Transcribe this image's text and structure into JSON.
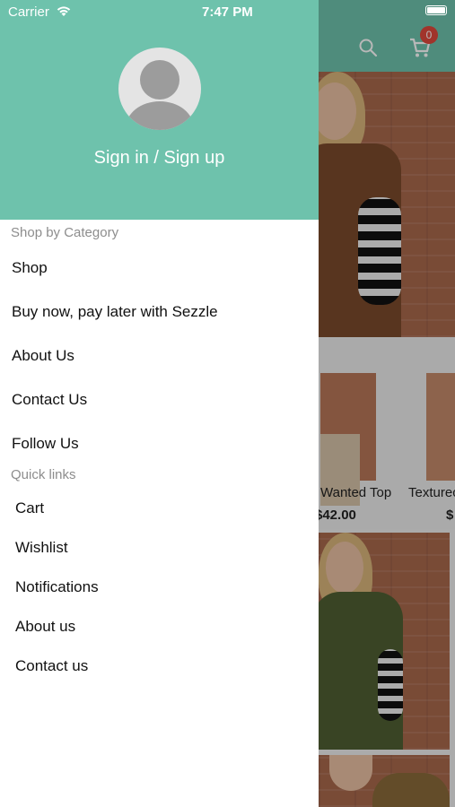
{
  "status_bar": {
    "carrier": "Carrier",
    "time": "7:47 PM"
  },
  "background": {
    "cart_badge": "0",
    "products": [
      {
        "name": "Wanted Top",
        "price": "$42.00"
      },
      {
        "name": "Texturec",
        "price": "$"
      }
    ],
    "icons": [
      "search-icon",
      "cart-icon"
    ]
  },
  "drawer": {
    "signin_label": "Sign in / Sign up",
    "shop_by_category": {
      "title": "Shop by Category",
      "items": [
        "Shop",
        "Buy now, pay later with Sezzle",
        "About Us",
        "Contact Us",
        "Follow Us"
      ]
    },
    "quick_links": {
      "title": "Quick links",
      "items": [
        "Cart",
        "Wishlist",
        "Notifications",
        "About us",
        "Contact us"
      ]
    }
  },
  "colors": {
    "accent": "#6ec2ac",
    "badge": "#e0483c"
  }
}
